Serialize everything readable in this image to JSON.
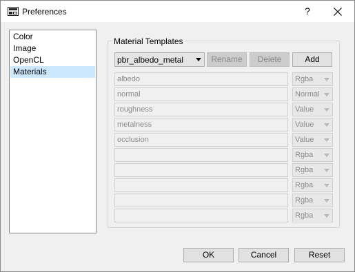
{
  "window": {
    "title": "Preferences",
    "help_label": "?"
  },
  "categories": [
    "Color",
    "Image",
    "OpenCL",
    "Materials"
  ],
  "selected_category": "Materials",
  "material_templates": {
    "group_title": "Material Templates",
    "template_select": "pbr_albedo_metal",
    "rename_label": "Rename",
    "delete_label": "Delete",
    "add_label": "Add",
    "rows": [
      {
        "name": "albedo",
        "type": "Rgba"
      },
      {
        "name": "normal",
        "type": "Normal"
      },
      {
        "name": "roughness",
        "type": "Value"
      },
      {
        "name": "metalness",
        "type": "Value"
      },
      {
        "name": "occlusion",
        "type": "Value"
      },
      {
        "name": "",
        "type": "Rgba"
      },
      {
        "name": "",
        "type": "Rgba"
      },
      {
        "name": "",
        "type": "Rgba"
      },
      {
        "name": "",
        "type": "Rgba"
      },
      {
        "name": "",
        "type": "Rgba"
      }
    ]
  },
  "footer": {
    "ok_label": "OK",
    "cancel_label": "Cancel",
    "reset_label": "Reset"
  },
  "colors": {
    "selection": "#cce8ff",
    "dialog_bg": "#f0f0f0"
  }
}
